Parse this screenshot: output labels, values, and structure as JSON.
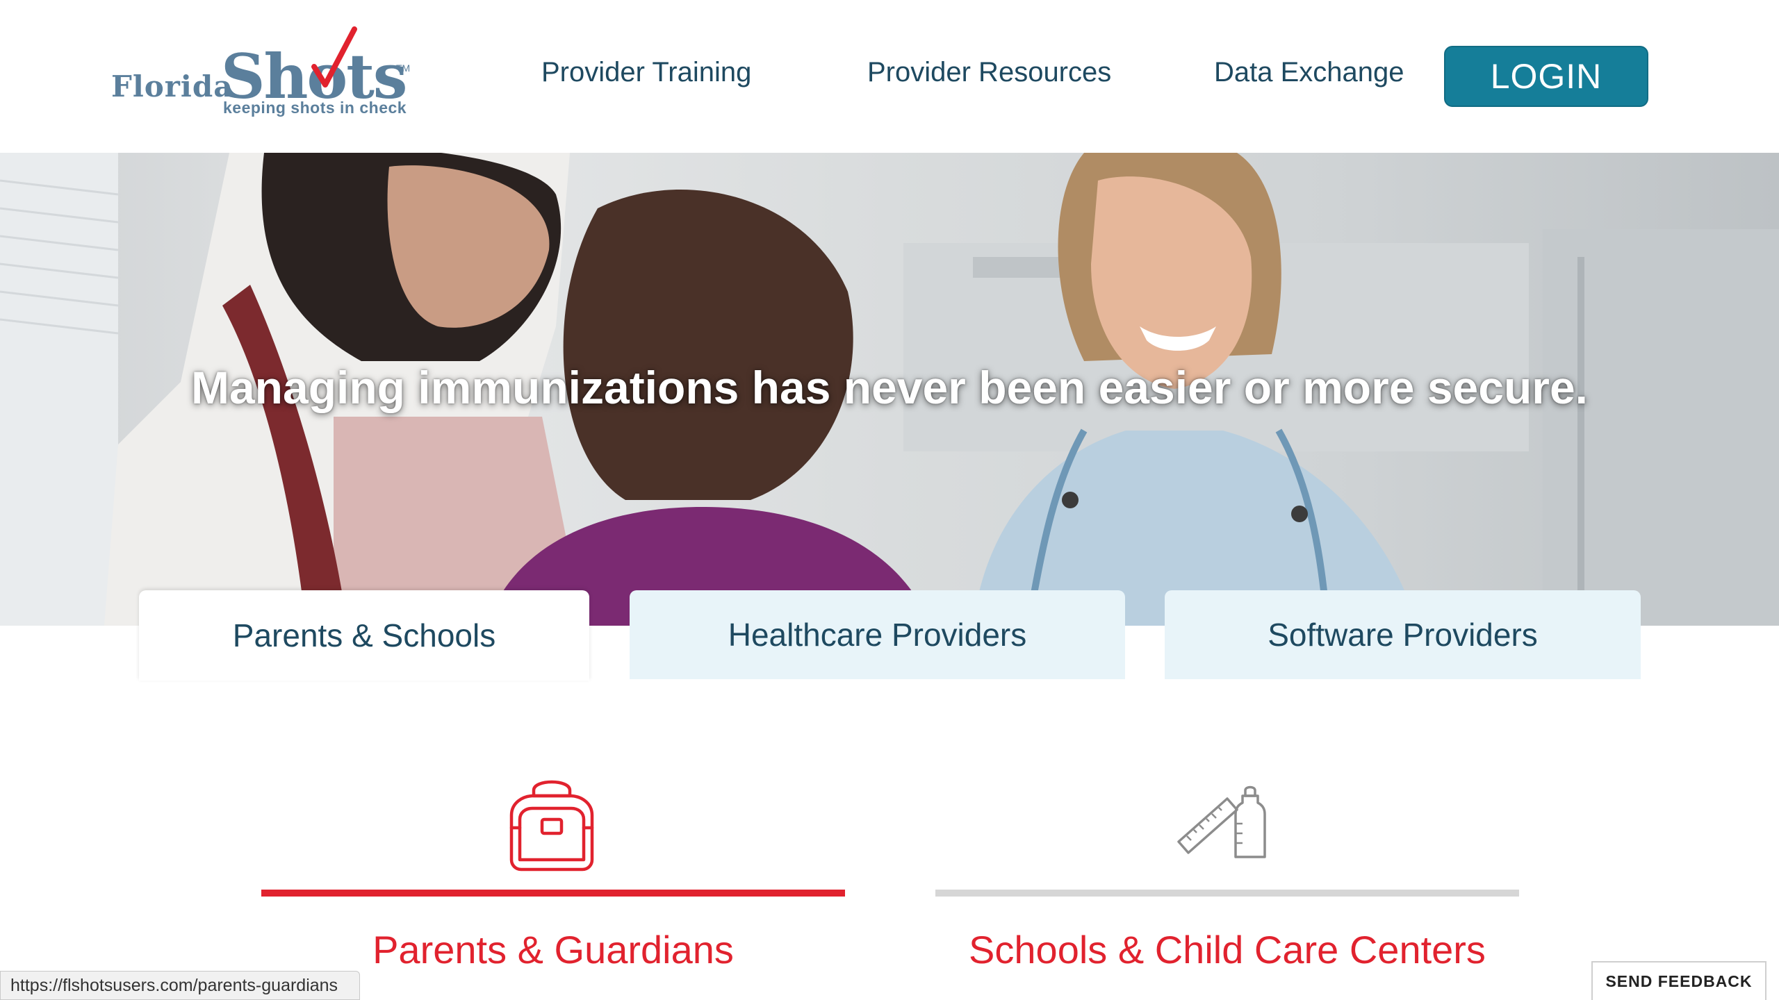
{
  "logo": {
    "word1": "Florida",
    "word2": "Shots",
    "trademark": "TM",
    "tagline": "keeping shots in check"
  },
  "nav": {
    "items": [
      "Provider Training",
      "Provider Resources",
      "Data Exchange"
    ],
    "login_label": "LOGIN"
  },
  "hero": {
    "headline": "Managing immunizations has never been easier or more secure."
  },
  "tabs": [
    {
      "label": "Parents & Schools",
      "active": true
    },
    {
      "label": "Healthcare Providers",
      "active": false
    },
    {
      "label": "Software Providers",
      "active": false
    }
  ],
  "categories": [
    {
      "title": "Parents & Guardians",
      "icon": "backpack-icon",
      "selected": true
    },
    {
      "title": "Schools & Child Care Centers",
      "icon": "ruler-bottle-icon",
      "selected": false
    }
  ],
  "status_bar": {
    "url": "https://flshotsusers.com/parents-guardians"
  },
  "feedback": {
    "label": "SEND FEEDBACK"
  },
  "colors": {
    "brand_blue": "#157e99",
    "nav_text": "#1e4960",
    "logo_slate": "#5b7f9c",
    "accent_red": "#e1222e",
    "tab_inactive_bg": "#e8f4f9",
    "divider_gray": "#d6d6d6"
  }
}
